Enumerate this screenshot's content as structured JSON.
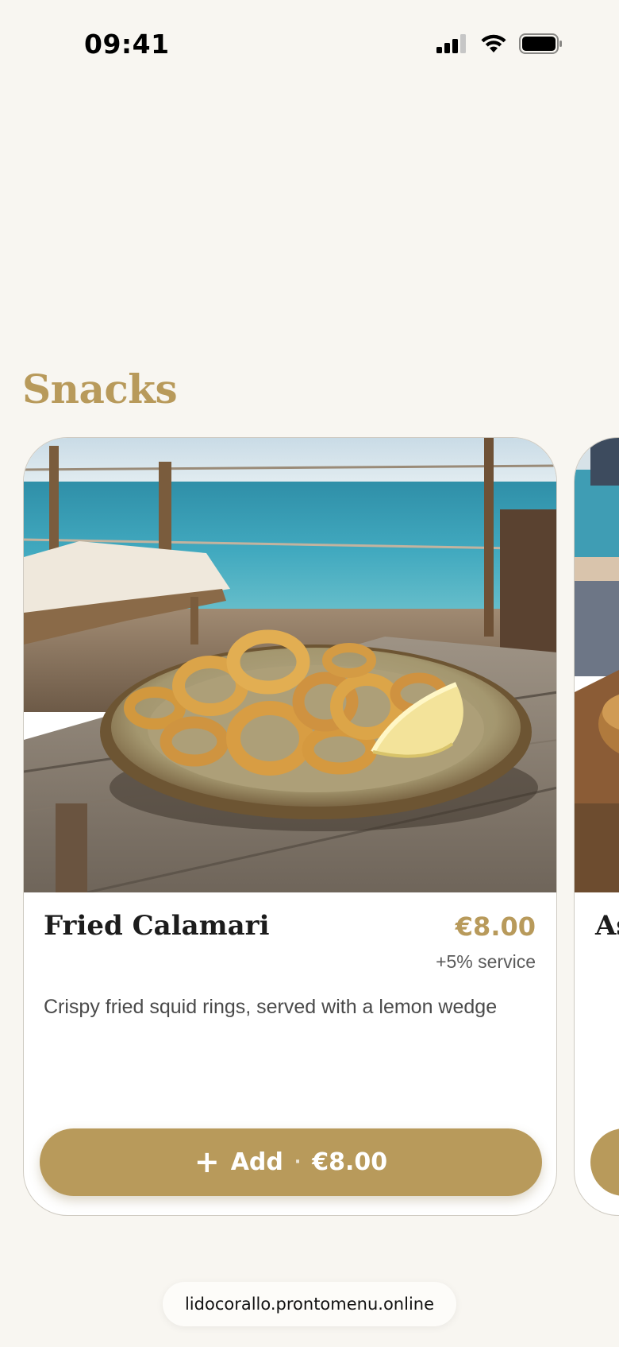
{
  "status_bar": {
    "time": "09:41",
    "icons": [
      "cellular-signal-icon",
      "wifi-icon",
      "battery-icon"
    ]
  },
  "section": {
    "title": "Snacks"
  },
  "colors": {
    "accent": "#b89a5b",
    "background": "#f8f6f1",
    "card": "#ffffff"
  },
  "cards": [
    {
      "image": "fried-calamari-photo",
      "name": "Fried Calamari",
      "price": "€8.00",
      "service": "+5% service",
      "description": "Crispy fried squid rings, served with a lemon wedge",
      "add_label": "Add",
      "add_separator": "·",
      "add_price": "€8.00"
    },
    {
      "image": "next-item-photo",
      "name_fragment": "As"
    }
  ],
  "browser": {
    "url": "lidocorallo.prontomenu.online"
  }
}
